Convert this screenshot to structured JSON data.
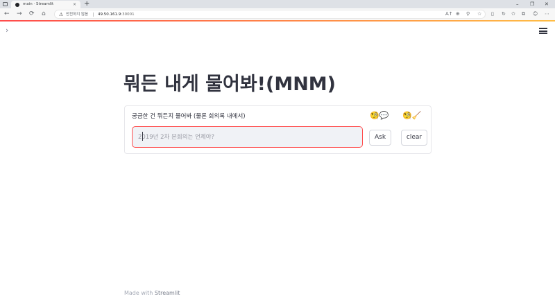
{
  "browser": {
    "tab_title": "main · Streamlit",
    "tab_close": "×",
    "new_tab": "+",
    "window_controls": {
      "minimize": "–",
      "restore": "❐",
      "close": "✕"
    },
    "nav": {
      "back": "←",
      "forward": "→",
      "reload": "⟳",
      "home": "⌂"
    },
    "address": {
      "security_warning": "안전하지 않음",
      "host": "49.50.161.9",
      "port": ":30001"
    },
    "toolbar_icons": [
      "A↑",
      "⊕",
      "⚲",
      "☆",
      "▯",
      "↻",
      "✩",
      "⧉",
      "☺",
      "⋯"
    ]
  },
  "app": {
    "sidebar_toggle": "›",
    "title": "뭐든 내게 물어봐!(MNM)",
    "question": {
      "label": "궁금한 건 뭐든지 물어봐 (물론 회의록 내에서)",
      "placeholder": "2019년 2차 본회의는 언제야?",
      "value": ""
    },
    "emoji_ask": "🧐💬",
    "emoji_clear": "🧐🧹",
    "ask_button": "Ask",
    "clear_button": "clear",
    "footer_prefix": "Made with ",
    "footer_brand": "Streamlit"
  },
  "colors": {
    "primary": "#ff4b4b",
    "text": "#31333f",
    "input_bg": "#f0f2f6"
  }
}
